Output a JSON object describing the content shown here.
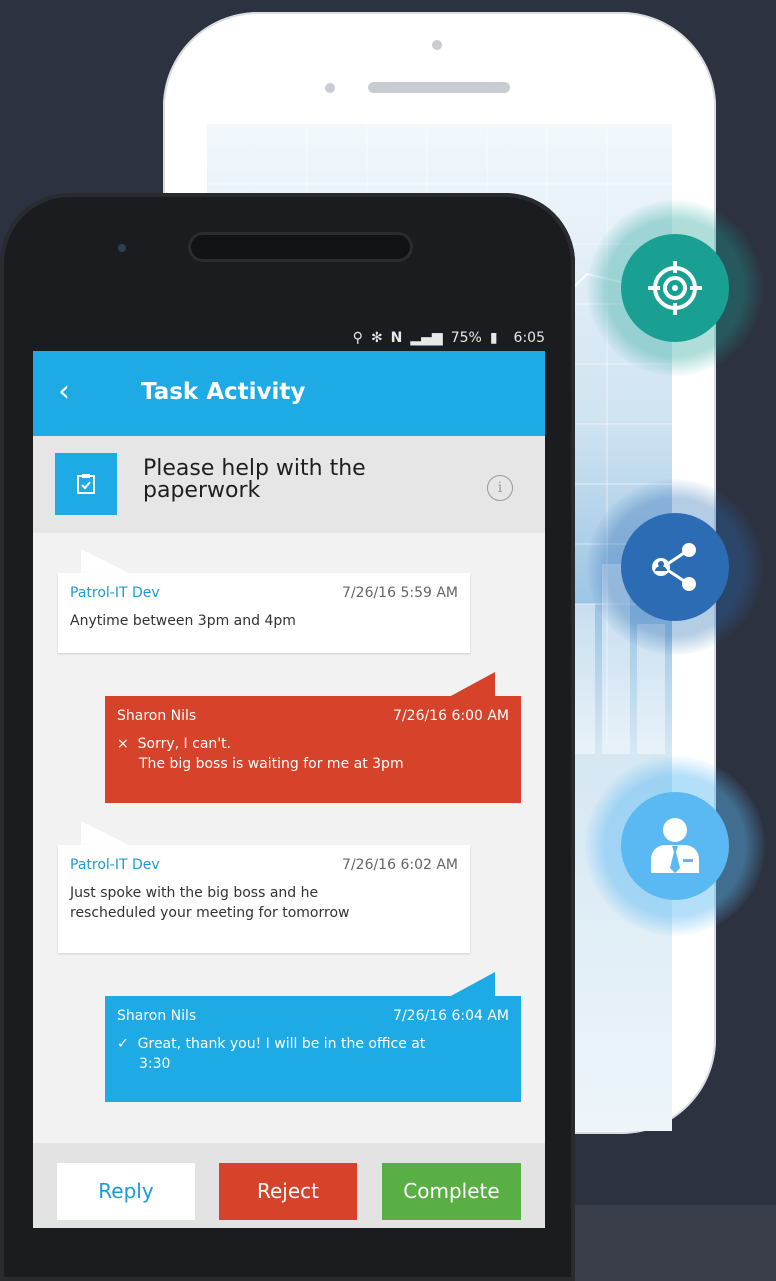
{
  "status_bar": {
    "battery": "75%",
    "time": "6:05"
  },
  "app_bar": {
    "back_icon": "chevron-left-icon",
    "title": "Task Activity"
  },
  "task": {
    "icon": "clipboard-check-icon",
    "title": "Please help with the paperwork",
    "info_icon": "info-icon"
  },
  "messages": [
    {
      "sender": "Patrol-IT Dev",
      "time": "7/26/16 5:59 AM",
      "body": "Anytime between 3pm and 4pm",
      "style": "incoming"
    },
    {
      "sender": "Sharon Nils",
      "time": "7/26/16 6:00 AM",
      "marker": "×",
      "line1": "Sorry, I can't.",
      "line2": "The big boss is waiting for me at 3pm",
      "style": "rejected"
    },
    {
      "sender": "Patrol-IT Dev",
      "time": "7/26/16 6:02 AM",
      "line1": "Just spoke with the big boss and he",
      "line2": "rescheduled your meeting for tomorrow",
      "style": "incoming"
    },
    {
      "sender": "Sharon Nils",
      "time": "7/26/16 6:04 AM",
      "marker": "✓",
      "line1": "Great, thank you! I will be in the office at",
      "line2": "3:30",
      "style": "accepted"
    }
  ],
  "actions": {
    "reply": "Reply",
    "reject": "Reject",
    "complete": "Complete"
  },
  "side_icons": [
    "target-icon",
    "share-user-icon",
    "businessman-icon"
  ],
  "colors": {
    "primary": "#1eaae4",
    "reject": "#d7422a",
    "complete": "#5aaf44",
    "teal": "#1aa093",
    "navy_blue": "#2b6cb5",
    "light_blue": "#5ab8f2",
    "background": "#2d3240"
  }
}
